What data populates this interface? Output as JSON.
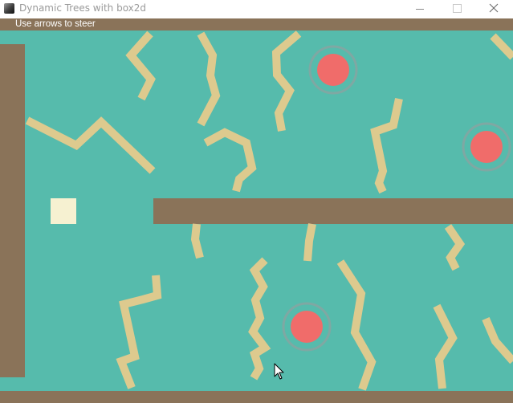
{
  "window": {
    "title": "Dynamic Trees with box2d",
    "icon": "app-icon",
    "controls": [
      "minimize-icon",
      "maximize-icon",
      "close-icon"
    ]
  },
  "game": {
    "hint": "Use arrows to steer",
    "colors": {
      "water": "#56bbac",
      "wall": "#8a7359",
      "branch": "#ddca8e",
      "player": "#f6f1d1",
      "target": "#f06c6a",
      "target_ring": "#7fa8a3"
    },
    "entities": {
      "player": "player-block",
      "targets": 3,
      "trees": 15
    }
  }
}
